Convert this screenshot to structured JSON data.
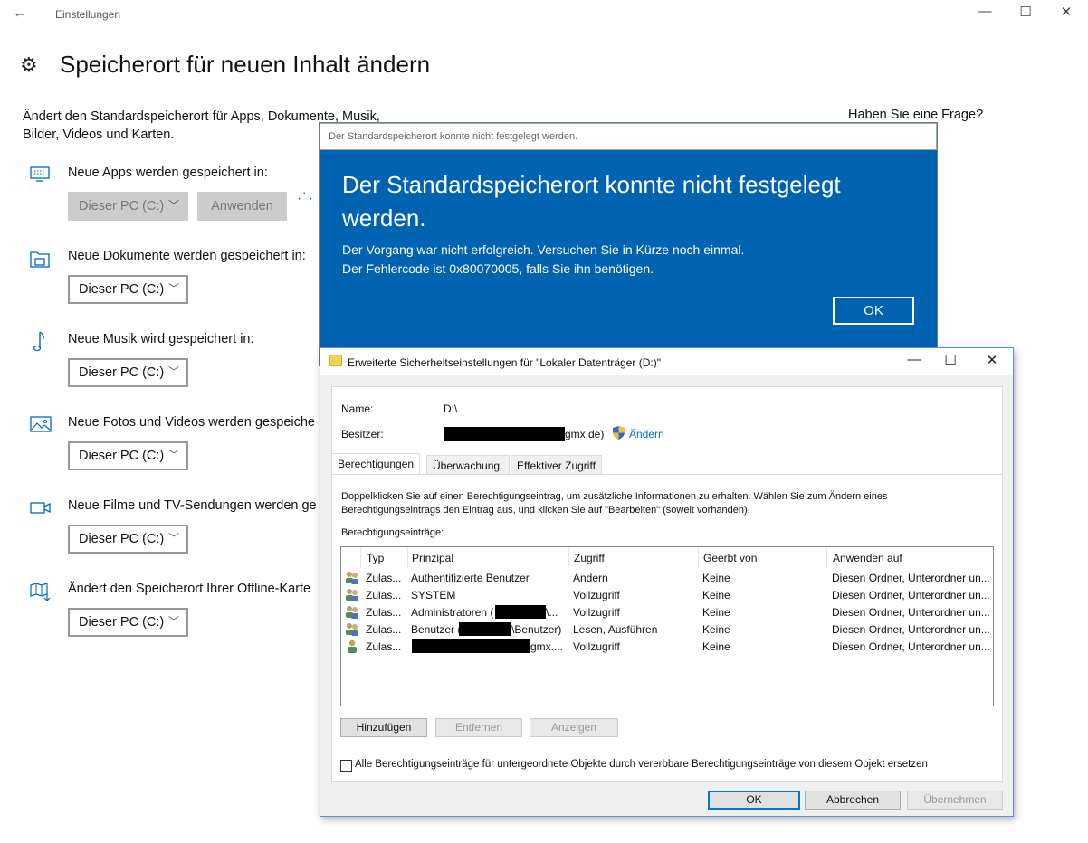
{
  "window": {
    "title": "Einstellungen",
    "back": "←",
    "minimize": "—",
    "maximize": "☐",
    "close": "✕"
  },
  "page": {
    "title": "Speicherort für neuen Inhalt ändern",
    "description": "Ändert den Standardspeicherort für Apps, Dokumente, Musik, Bilder, Videos und Karten.",
    "question": "Haben Sie eine Frage?"
  },
  "sections": [
    {
      "label": "Neue Apps werden gespeichert in:",
      "value": "Dieser PC (C:)",
      "apply": "Anwenden",
      "icon": "monitor-icon"
    },
    {
      "label": "Neue Dokumente werden gespeichert in:",
      "value": "Dieser PC (C:)",
      "icon": "documents-icon"
    },
    {
      "label": "Neue Musik wird gespeichert in:",
      "value": "Dieser PC (C:)",
      "icon": "music-note-icon"
    },
    {
      "label": "Neue Fotos und Videos werden gespeiche",
      "value": "Dieser PC (C:)",
      "icon": "photo-icon"
    },
    {
      "label": "Neue Filme und TV-Sendungen werden ge",
      "value": "Dieser PC (C:)",
      "icon": "video-camera-icon"
    },
    {
      "label": "Ändert den Speicherort Ihrer Offline-Karte",
      "value": "Dieser PC (C:)",
      "icon": "map-download-icon"
    }
  ],
  "error_dialog": {
    "bar_title": "Der Standardspeicherort konnte nicht festgelegt werden.",
    "heading": "Der Standardspeicherort konnte nicht festgelegt werden.",
    "line1": "Der Vorgang war nicht erfolgreich. Versuchen Sie in Kürze noch einmal.",
    "line2": "Der Fehlercode ist 0x80070005, falls Sie ihn benötigen.",
    "ok": "OK",
    "background": "#0063b1"
  },
  "security_dialog": {
    "title": "Erweiterte Sicherheitseinstellungen für \"Lokaler Datenträger (D:)\"",
    "name_label": "Name:",
    "name_value": "D:\\",
    "owner_label": "Besitzer:",
    "owner_suffix": "gmx.de)",
    "owner_change": "Ändern",
    "tabs": [
      "Berechtigungen",
      "Überwachung",
      "Effektiver Zugriff"
    ],
    "instructions": "Doppelklicken Sie auf einen Berechtigungseintrag, um zusätzliche Informationen zu erhalten. Wählen Sie zum Ändern eines Berechtigungseintrags den Eintrag aus, und klicken Sie auf \"Bearbeiten\" (soweit vorhanden).",
    "entries_label": "Berechtigungseinträge:",
    "columns": [
      "Typ",
      "Prinzipal",
      "Zugriff",
      "Geerbt von",
      "Anwenden auf"
    ],
    "rows": [
      {
        "type": "Zulas...",
        "principal": "Authentifizierte Benutzer",
        "access": "Ändern",
        "inherited": "Keine",
        "applies": "Diesen Ordner, Unterordner un..."
      },
      {
        "type": "Zulas...",
        "principal": "SYSTEM",
        "access": "Vollzugriff",
        "inherited": "Keine",
        "applies": "Diesen Ordner, Unterordner un..."
      },
      {
        "type": "Zulas...",
        "principal": "Administratoren (",
        "principal_tail": "\\...",
        "access": "Vollzugriff",
        "inherited": "Keine",
        "applies": "Diesen Ordner, Unterordner un..."
      },
      {
        "type": "Zulas...",
        "principal": "Benutzer (",
        "principal_tail": "\\Benutzer)",
        "access": "Lesen, Ausführen",
        "inherited": "Keine",
        "applies": "Diesen Ordner, Unterordner un..."
      },
      {
        "type": "Zulas...",
        "principal": "",
        "principal_tail": "gmx....",
        "access": "Vollzugriff",
        "inherited": "Keine",
        "applies": "Diesen Ordner, Unterordner un..."
      }
    ],
    "add": "Hinzufügen",
    "remove": "Entfernen",
    "view": "Anzeigen",
    "replace_checkbox": "Alle Berechtigungseinträge für untergeordnete Objekte durch vererbbare Berechtigungseinträge von diesem Objekt ersetzen",
    "ok": "OK",
    "cancel": "Abbrechen",
    "apply": "Übernehmen",
    "minimize": "—",
    "maximize": "☐",
    "close": "✕"
  }
}
